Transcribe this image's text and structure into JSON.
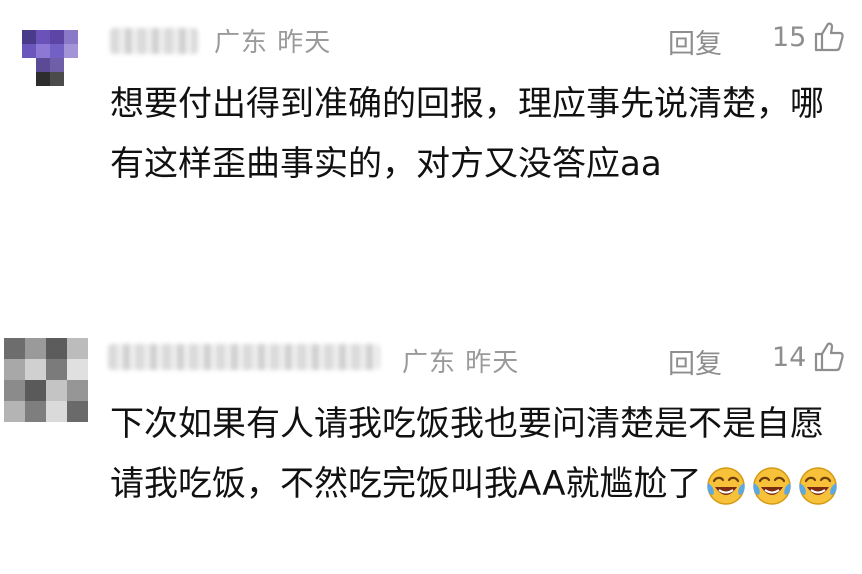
{
  "comments": [
    {
      "location": "广东 昨天",
      "reply_label": "回复",
      "like_count": "15",
      "text": "想要付出得到准确的回报，理应事先说清楚，哪有这样歪曲事实的，对方又没答应aa"
    },
    {
      "location": "广东 昨天",
      "reply_label": "回复",
      "like_count": "14",
      "text": "下次如果有人请我吃饭我也要问清楚是不是自愿请我吃饭，不然吃完饭叫我AA就尴尬了",
      "emojis": [
        "laughing-crying-emoji",
        "laughing-crying-emoji",
        "laughing-crying-emoji"
      ]
    }
  ],
  "colors": {
    "meta_text": "#9a9a9a",
    "body_text": "#111111"
  }
}
